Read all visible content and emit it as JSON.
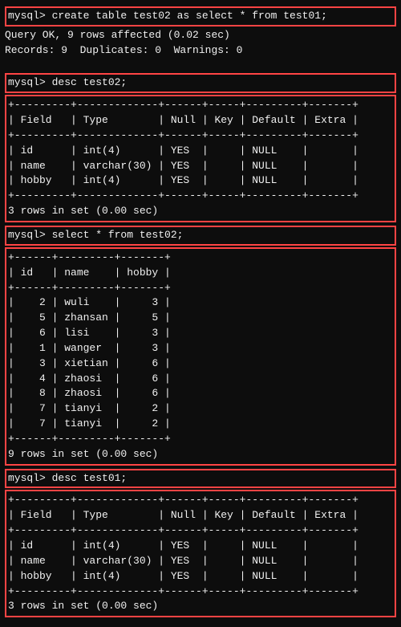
{
  "terminal": {
    "block1": {
      "cmd": "mysql> create table test02 as select * from test01;",
      "result1": "Query OK, 9 rows affected (0.02 sec)",
      "result2": "Records: 9  Duplicates: 0  Warnings: 0"
    },
    "block2": {
      "cmd": "mysql> desc test02;",
      "separator1": "+---------+-------------+------+-----+---------+-------+",
      "header": "| Field   | Type        | Null | Key | Default | Extra |",
      "separator2": "+---------+-------------+------+-----+---------+-------+",
      "rows": [
        "| id      | int(4)      | YES  |     | NULL    |       |",
        "| name    | varchar(30) | YES  |     | NULL    |       |",
        "| hobby   | int(4)      | YES  |     | NULL    |       |"
      ],
      "separator3": "+---------+-------------+------+-----+---------+-------+",
      "footer": "3 rows in set (0.00 sec)"
    },
    "block3": {
      "cmd": "mysql> select * from test02;",
      "separator1": "+------+---------+-------+",
      "header": "| id   | name    | hobby |",
      "separator2": "+------+---------+-------+",
      "rows": [
        "|    2 | wuli    |     3 |",
        "|    5 | zhansan |     5 |",
        "|    6 | lisi    |     3 |",
        "|    1 | wanger  |     3 |",
        "|    3 | xietian |     6 |",
        "|    4 | zhaosi  |     6 |",
        "|    8 | zhaosi  |     6 |",
        "|    7 | tianyi  |     2 |",
        "|    7 | tianyi  |     2 |"
      ],
      "separator3": "+------+---------+-------+",
      "footer": "9 rows in set (0.00 sec)"
    },
    "block4": {
      "cmd": "mysql> desc test01;",
      "separator1": "+---------+-------------+------+-----+---------+-------+",
      "header": "| Field   | Type        | Null | Key | Default | Extra |",
      "separator2": "+---------+-------------+------+-----+---------+-------+",
      "rows": [
        "| id      | int(4)      | YES  |     | NULL    |       |",
        "| name    | varchar(30) | YES  |     | NULL    |       |",
        "| hobby   | int(4)      | YES  |     | NULL    |       |"
      ],
      "separator3": "+---------+-------------+------+-----+---------+-------+",
      "footer": "3 rows in set (0.00 sec)"
    }
  }
}
